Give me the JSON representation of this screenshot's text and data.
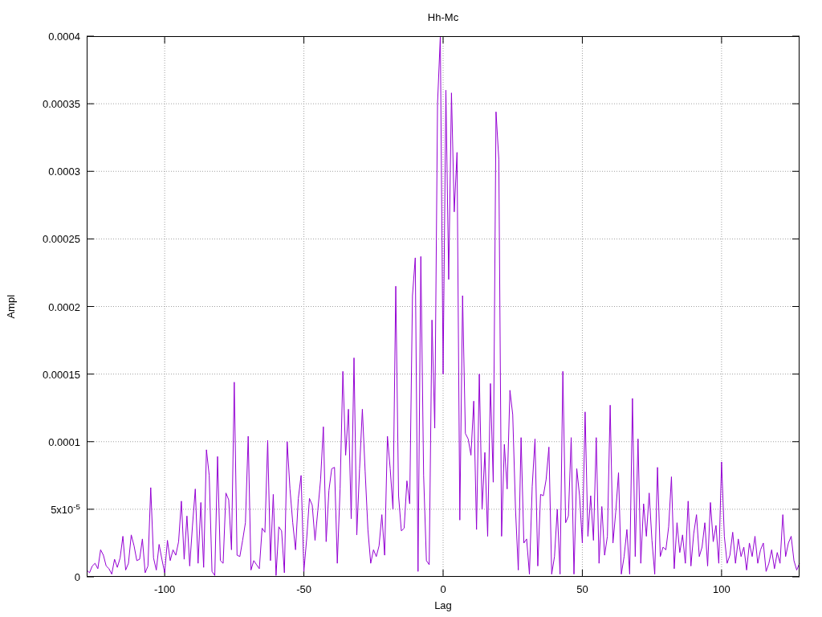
{
  "chart_data": {
    "type": "line",
    "title": "Hh-Mc",
    "xlabel": "Lag",
    "ylabel": "Ampl",
    "xlim": [
      -128,
      128
    ],
    "ylim": [
      0,
      0.0004
    ],
    "xticks": [
      -100,
      -50,
      0,
      50,
      100
    ],
    "grid": true,
    "x": [
      -128,
      -127,
      -126,
      -125,
      -124,
      -123,
      -122,
      -121,
      -120,
      -119,
      -118,
      -117,
      -116,
      -115,
      -114,
      -113,
      -112,
      -111,
      -110,
      -109,
      -108,
      -107,
      -106,
      -105,
      -104,
      -103,
      -102,
      -101,
      -100,
      -99,
      -98,
      -97,
      -96,
      -95,
      -94,
      -93,
      -92,
      -91,
      -90,
      -89,
      -88,
      -87,
      -86,
      -85,
      -84,
      -83,
      -82,
      -81,
      -80,
      -79,
      -78,
      -77,
      -76,
      -75,
      -74,
      -73,
      -72,
      -71,
      -70,
      -69,
      -68,
      -67,
      -66,
      -65,
      -64,
      -63,
      -62,
      -61,
      -60,
      -59,
      -58,
      -57,
      -56,
      -55,
      -54,
      -53,
      -52,
      -51,
      -50,
      -49,
      -48,
      -47,
      -46,
      -45,
      -44,
      -43,
      -42,
      -41,
      -40,
      -39,
      -38,
      -37,
      -36,
      -35,
      -34,
      -33,
      -32,
      -31,
      -30,
      -29,
      -28,
      -27,
      -26,
      -25,
      -24,
      -23,
      -22,
      -21,
      -20,
      -19,
      -18,
      -17,
      -16,
      -15,
      -14,
      -13,
      -12,
      -11,
      -10,
      -9,
      -8,
      -7,
      -6,
      -5,
      -4,
      -3,
      -2,
      -1,
      0,
      1,
      2,
      3,
      4,
      5,
      6,
      7,
      8,
      9,
      10,
      11,
      12,
      13,
      14,
      15,
      16,
      17,
      18,
      19,
      20,
      21,
      22,
      23,
      24,
      25,
      26,
      27,
      28,
      29,
      30,
      31,
      32,
      33,
      34,
      35,
      36,
      37,
      38,
      39,
      40,
      41,
      42,
      43,
      44,
      45,
      46,
      47,
      48,
      49,
      50,
      51,
      52,
      53,
      54,
      55,
      56,
      57,
      58,
      59,
      60,
      61,
      62,
      63,
      64,
      65,
      66,
      67,
      68,
      69,
      70,
      71,
      72,
      73,
      74,
      75,
      76,
      77,
      78,
      79,
      80,
      81,
      82,
      83,
      84,
      85,
      86,
      87,
      88,
      89,
      90,
      91,
      92,
      93,
      94,
      95,
      96,
      97,
      98,
      99,
      100,
      101,
      102,
      103,
      104,
      105,
      106,
      107,
      108,
      109,
      110,
      111,
      112,
      113,
      114,
      115,
      116,
      117,
      118,
      119,
      120,
      121,
      122,
      123,
      124,
      125,
      126,
      127,
      128
    ],
    "yticks": [
      {
        "value": 0,
        "label": "0"
      },
      {
        "value": 5e-05,
        "label": "5x10$^{-5}$"
      },
      {
        "value": 0.0001,
        "label": "0.0001"
      },
      {
        "value": 0.00015,
        "label": "0.00015"
      },
      {
        "value": 0.0002,
        "label": "0.0002"
      },
      {
        "value": 0.00025,
        "label": "0.00025"
      },
      {
        "value": 0.0003,
        "label": "0.0003"
      },
      {
        "value": 0.00035,
        "label": "0.00035"
      },
      {
        "value": 0.0004,
        "label": "0.0004"
      }
    ],
    "series": [
      {
        "color": "#9400d3",
        "values": [
          5e-06,
          3e-06,
          8e-06,
          1e-05,
          6e-06,
          2e-05,
          1.6e-05,
          8e-06,
          6e-06,
          2e-06,
          1.3e-05,
          7e-06,
          1.4e-05,
          3e-05,
          5e-06,
          1e-05,
          3.1e-05,
          2.3e-05,
          1.2e-05,
          1.3e-05,
          2.8e-05,
          3e-06,
          8e-06,
          6.6e-05,
          1.4e-05,
          5e-06,
          2.4e-05,
          1.3e-05,
          3e-06,
          2.7e-05,
          1.2e-05,
          2e-05,
          1.6e-05,
          2.6e-05,
          5.6e-05,
          1.3e-05,
          4.5e-05,
          8e-06,
          3.8e-05,
          6.5e-05,
          1e-05,
          5.5e-05,
          7e-06,
          9.4e-05,
          7.5e-05,
          4e-06,
          1e-06,
          8.9e-05,
          1.2e-05,
          1e-05,
          6.2e-05,
          5.7e-05,
          2e-05,
          0.000144,
          1.6e-05,
          1.5e-05,
          2.7e-05,
          4e-05,
          0.000104,
          5e-06,
          1.2e-05,
          9e-06,
          6e-06,
          3.6e-05,
          3.3e-05,
          0.000101,
          1.2e-05,
          6.1e-05,
          1e-06,
          3.7e-05,
          3.4e-05,
          3e-06,
          0.0001,
          6.5e-05,
          4e-05,
          2e-05,
          5.8e-05,
          7.5e-05,
          4e-06,
          2.8e-05,
          5.8e-05,
          5.3e-05,
          2.7e-05,
          4.9e-05,
          7.2e-05,
          0.000111,
          2.6e-05,
          6.4e-05,
          8e-05,
          8.1e-05,
          1e-05,
          6.5e-05,
          0.000152,
          9e-05,
          0.000124,
          4.3e-05,
          0.000162,
          3.1e-05,
          8e-05,
          0.000124,
          7.8e-05,
          3.5e-05,
          1e-05,
          2e-05,
          1.5e-05,
          2.3e-05,
          4.6e-05,
          1.6e-05,
          0.000104,
          8e-05,
          5e-05,
          0.000215,
          6e-05,
          3.4e-05,
          3.6e-05,
          7.1e-05,
          5.4e-05,
          0.000208,
          0.000236,
          4e-06,
          0.000237,
          7.5e-05,
          1.2e-05,
          9e-06,
          0.00019,
          0.00011,
          0.00035,
          0.0004,
          0.00015,
          0.00036,
          0.00022,
          0.000358,
          0.00027,
          0.000314,
          4.2e-05,
          0.000208,
          0.000106,
          0.000102,
          9e-05,
          0.00013,
          3.5e-05,
          0.00015,
          5e-05,
          9.2e-05,
          3e-05,
          0.000143,
          7e-05,
          0.000344,
          0.000309,
          3e-05,
          9.8e-05,
          6.5e-05,
          0.000138,
          0.00012,
          5e-05,
          5e-06,
          0.000103,
          2.5e-05,
          2.8e-05,
          2e-06,
          6.7e-05,
          0.000102,
          8e-06,
          6.1e-05,
          6e-05,
          7.2e-05,
          9.6e-05,
          2e-06,
          1.5e-05,
          5e-05,
          2e-06,
          0.000152,
          4e-05,
          4.5e-05,
          0.000103,
          2e-06,
          8e-05,
          6e-05,
          2.5e-05,
          0.000122,
          3e-05,
          6e-05,
          2.7e-05,
          0.000103,
          1e-05,
          5.2e-05,
          1.6e-05,
          3e-05,
          0.000127,
          2.5e-05,
          4.8e-05,
          7.7e-05,
          2e-06,
          1.5e-05,
          3.5e-05,
          2e-06,
          0.000132,
          1.5e-05,
          0.000102,
          1e-05,
          5.4e-05,
          3e-05,
          6.2e-05,
          2.7e-05,
          2e-06,
          8.1e-05,
          1.5e-05,
          2.2e-05,
          2e-05,
          3.7e-05,
          7.4e-05,
          6e-06,
          4e-05,
          1.8e-05,
          3.1e-05,
          1e-05,
          5.6e-05,
          8e-06,
          3.2e-05,
          4.6e-05,
          1.5e-05,
          2.2e-05,
          4e-05,
          8e-06,
          5.5e-05,
          2.6e-05,
          3.8e-05,
          1e-05,
          8.5e-05,
          3e-05,
          1e-05,
          1.6e-05,
          3.3e-05,
          1e-05,
          2.8e-05,
          1.5e-05,
          2.2e-05,
          5e-06,
          2.5e-05,
          1.5e-05,
          3e-05,
          1e-05,
          2e-05,
          2.5e-05,
          4e-06,
          1e-05,
          2e-05,
          6e-06,
          1.8e-05,
          1e-05,
          4.6e-05,
          1.5e-05,
          2.5e-05,
          3e-05,
          1.2e-05,
          5e-06,
          1e-05
        ]
      }
    ]
  }
}
